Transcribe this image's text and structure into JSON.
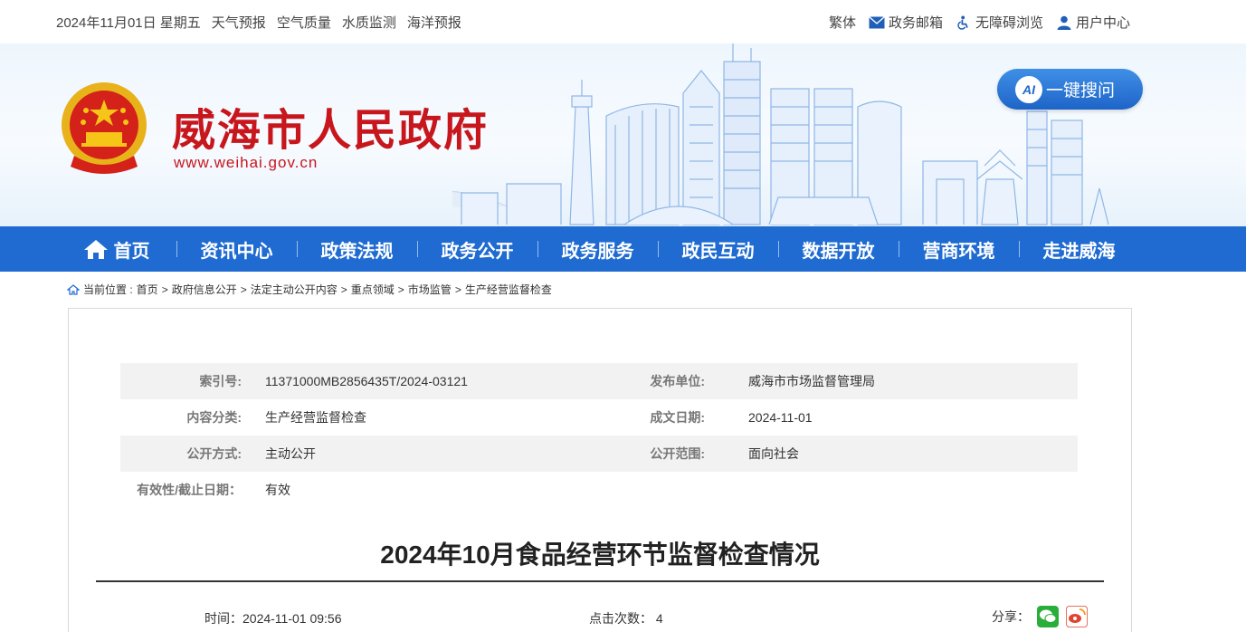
{
  "topbar": {
    "date": "2024年11月01日 星期五",
    "links": [
      "天气预报",
      "空气质量",
      "水质监测",
      "海洋预报"
    ],
    "traditional": "繁体",
    "mailbox": "政务邮箱",
    "accessibility": "无障碍浏览",
    "user_center": "用户中心"
  },
  "header": {
    "site_title": "威海市人民政府",
    "site_url": "www.weihai.gov.cn",
    "ai_badge": "AI",
    "ai_search": "一键搜问"
  },
  "nav": {
    "items": [
      "首页",
      "资讯中心",
      "政策法规",
      "政务公开",
      "政务服务",
      "政民互动",
      "数据开放",
      "营商环境",
      "走进威海"
    ]
  },
  "breadcrumb": {
    "prefix": "当前位置 :",
    "items": [
      "首页",
      "政府信息公开",
      "法定主动公开内容",
      "重点领域",
      "市场监管",
      "生产经营监督检查"
    ],
    "separator": ">"
  },
  "meta": {
    "index_label": "索引号:",
    "index_value": "11371000MB2856435T/2024-03121",
    "publisher_label": "发布单位:",
    "publisher_value": "威海市市场监督管理局",
    "category_label": "内容分类:",
    "category_value": "生产经营监督检查",
    "date_label": "成文日期:",
    "date_value": "2024-11-01",
    "method_label": "公开方式:",
    "method_value": "主动公开",
    "scope_label": "公开范围:",
    "scope_value": "面向社会",
    "validity_label": "有效性/截止日期：",
    "validity_value": "有效"
  },
  "article": {
    "title": "2024年10月食品经营环节监督检查情况",
    "time_label": "时间：",
    "time_value": "2024-11-01 09:56",
    "clicks_label": "点击次数：",
    "clicks_value": "4",
    "share_label": "分享："
  },
  "colors": {
    "brand_red": "#c8161d",
    "nav_blue": "#1f6bd1",
    "meta_shade": "#f2f2f2"
  }
}
